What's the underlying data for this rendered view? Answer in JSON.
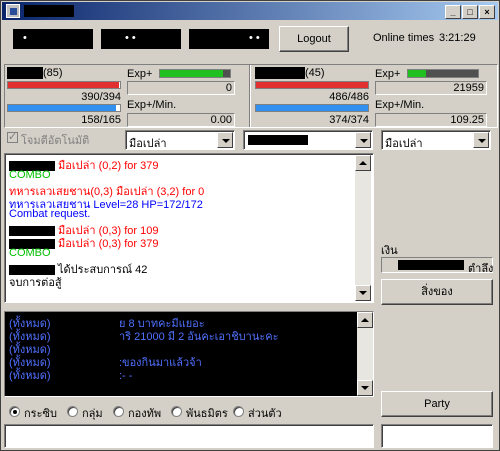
{
  "window": {
    "minimize_glyph": "_",
    "maximize_glyph": "□",
    "close_glyph": "×"
  },
  "header": {
    "field_dots": [
      "•",
      "• •",
      "• •"
    ],
    "logout_label": "Logout",
    "online_label": "Online times",
    "online_time": "3:21:29"
  },
  "player_left": {
    "level": "(85)",
    "hp": "390/394",
    "mp": "158/165",
    "hp_fraction": 0.99,
    "mp_fraction": 0.96,
    "exp_label": "Exp+",
    "exp_value": "0",
    "exp_fraction": 0.9,
    "exp_min_label": "Exp+/Min.",
    "exp_min_value": "0.00"
  },
  "player_right": {
    "level": "(45)",
    "hp": "486/486",
    "mp": "374/374",
    "hp_fraction": 1.0,
    "mp_fraction": 1.0,
    "exp_label": "Exp+",
    "exp_value": "21959",
    "exp_fraction": 0.25,
    "exp_min_label": "Exp+/Min.",
    "exp_min_value": "109.25"
  },
  "controls": {
    "auto_checkbox_label": "โจมตีอัตโนมัติ",
    "left_weapon": "มือเปล่า",
    "right_weapon": "มือเปล่า"
  },
  "battle_log": [
    {
      "text": "มือเปล่า (0,2) for 379",
      "color": "#ff0000",
      "redact": true
    },
    {
      "text": "COMBO",
      "color": "#00c000",
      "redact": false
    },
    {
      "text": "ทหารเลวเสยชาน(0,3) มือเปล่า (3,2) for 0",
      "color": "#ff0000",
      "redact": false
    },
    {
      "text": "ทหารเลวเสยชาน Level=28 HP=172/172",
      "color": "#0000ff",
      "redact": false
    },
    {
      "text": "Combat request.",
      "color": "#0000ff",
      "redact": false
    },
    {
      "text": "มือเปล่า (0,3) for 109",
      "color": "#ff0000",
      "redact": true
    },
    {
      "text": "มือเปล่า (0,3) for 379",
      "color": "#ff0000",
      "redact": true
    },
    {
      "text": "COMBO",
      "color": "#00c000",
      "redact": false
    },
    {
      "text": "ได้ประสบการณ์ 42",
      "color": "#000000",
      "redact": true
    },
    {
      "text": "จบการต่อสู้",
      "color": "#000000",
      "redact": false
    }
  ],
  "side": {
    "money_label": "เงิน",
    "money_suffix": "ตำลึง",
    "items_button": "สิ่งของ",
    "party_button": "Party"
  },
  "chat": [
    {
      "prefix": "(ทั้งหมด)",
      "msg": "ย 8 บาทคะมีแยอะ"
    },
    {
      "prefix": "(ทั้งหมด)",
      "msg": "าริ 21000 มี 2 อันคะเอาชิบานะคะ"
    },
    {
      "prefix": "(ทั้งหมด)",
      "msg": ""
    },
    {
      "prefix": "(ทั้งหมด)",
      "msg": ":ของกินมาแล้วจ้า"
    },
    {
      "prefix": "(ทั้งหมด)",
      "msg": ":- -"
    }
  ],
  "chat_modes": [
    "กระซิบ",
    "กลุ่ม",
    "กองทัพ",
    "พันธมิตร",
    "ส่วนตัว"
  ],
  "colors": {
    "hp": "#e03030",
    "mp": "#3090f0",
    "exp": "#20c020",
    "chat_bg": "#000000",
    "chat_text": "#5070ff"
  }
}
